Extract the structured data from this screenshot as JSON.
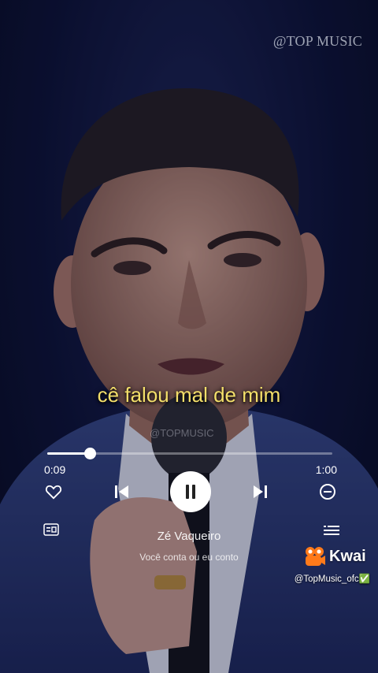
{
  "watermark": {
    "top": "@TOP MUSIC",
    "center": "@TOPMUSIC"
  },
  "lyric": {
    "current_line": "cê falou mal de mim"
  },
  "player": {
    "current_time": "0:09",
    "total_time": "1:00",
    "progress": 0.15,
    "state": "playing",
    "icons": {
      "favorite": "heart-icon",
      "previous": "skip-previous-icon",
      "play_pause": "pause-icon",
      "next": "skip-next-icon",
      "remove": "minus-circle-icon",
      "lyrics": "lyrics-icon",
      "queue": "playlist-icon"
    }
  },
  "track": {
    "artist": "Zé Vaqueiro",
    "title": "Você conta ou eu conto"
  },
  "branding": {
    "app_name": "Kwai",
    "handle": "@TopMusic_ofc✅",
    "accent": "#ff7a1a"
  },
  "colors": {
    "lyric": "#f3df6a",
    "background": "#0b1030"
  }
}
